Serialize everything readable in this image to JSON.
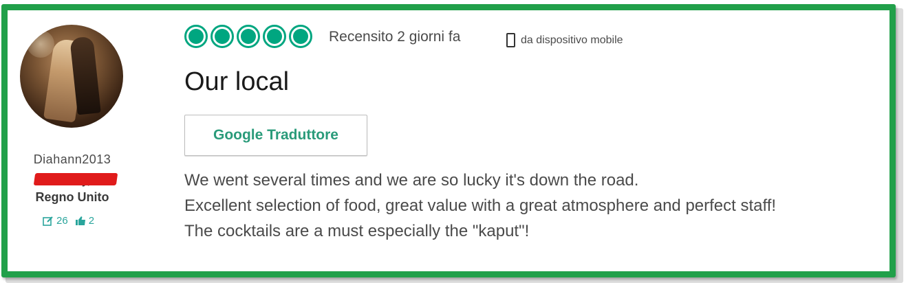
{
  "reviewer": {
    "username": "Diahann2013",
    "location_line1": "R...y,",
    "location_line2": "Regno Unito",
    "reviews_count": "26",
    "helpful_votes": "2"
  },
  "review": {
    "rating": 5,
    "rating_max": 5,
    "date_label": "Recensito 2 giorni fa",
    "device_label": "da dispositivo mobile",
    "title": "Our local",
    "translate_button": "Google Traduttore",
    "body_lines": [
      "We went several times and we are so lucky it's down the road.",
      "Excellent selection of food, great value with a great atmosphere and perfect staff!",
      "The cocktails are a must especially the \"kaput\"!"
    ]
  },
  "colors": {
    "frame_border": "#21a04a",
    "bubble": "#00a680",
    "link": "#2a9b7a",
    "redaction": "#e01b1b"
  },
  "icons": {
    "reviews": "pencil-box-icon",
    "helpful": "thumbs-up-icon",
    "device": "mobile-phone-icon"
  }
}
